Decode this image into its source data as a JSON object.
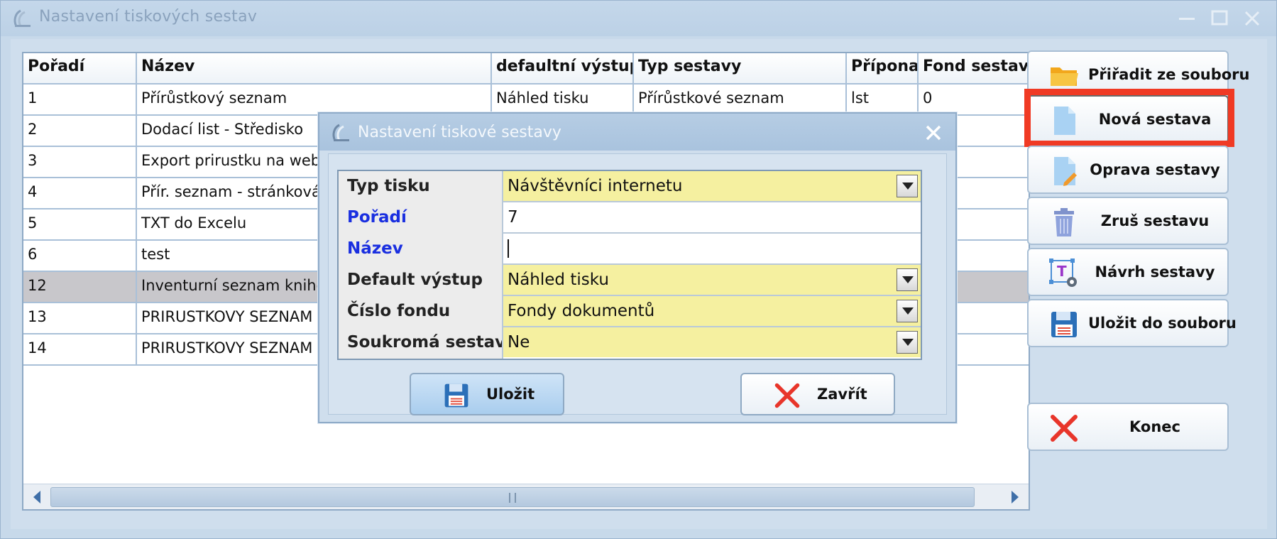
{
  "window": {
    "title": "Nastavení tiskových sestav"
  },
  "grid": {
    "columns": [
      "Pořadí",
      "Název",
      "defaultní výstup",
      "Typ sestavy",
      "Přípona",
      "Fond sestav"
    ],
    "rows": [
      [
        "1",
        "Přírůstkový seznam",
        "Náhled tisku",
        "Přírůstkové seznam",
        "lst",
        "0"
      ],
      [
        "2",
        "Dodací list - Středisko",
        "",
        "",
        "",
        ""
      ],
      [
        "3",
        "Export prirustku na web",
        "",
        "",
        "",
        ""
      ],
      [
        "4",
        "Přír. seznam - stránková s",
        "",
        "",
        "",
        ""
      ],
      [
        "5",
        "TXT do Excelu",
        "",
        "",
        "",
        ""
      ],
      [
        "6",
        "test",
        "",
        "",
        "",
        ""
      ],
      [
        "12",
        "Inventurní seznam knihovn",
        "",
        "",
        "",
        ""
      ],
      [
        "13",
        "PRIRUSTKOVY SEZNAM NA",
        "",
        "",
        "",
        ""
      ],
      [
        "14",
        "PRIRUSTKOVY SEZNAM KO",
        "",
        "",
        "",
        ""
      ]
    ],
    "selected_row": 6
  },
  "buttons": {
    "assign_from_file": "Přiřadit ze souboru",
    "new_report": "Nová sestava",
    "edit_report": "Oprava sestavy",
    "delete_report": "Zruš sestavu",
    "design_report": "Návrh sestavy",
    "save_to_file": "Uložit do souboru",
    "end": "Konec"
  },
  "dialog": {
    "title": "Nastavení tiskové sestavy",
    "fields": {
      "typ_tisku": {
        "label": "Typ tisku",
        "value": "Návštěvníci internetu"
      },
      "poradi": {
        "label": "Pořadí",
        "value": "7"
      },
      "nazev": {
        "label": "Název",
        "value": ""
      },
      "default_vystup": {
        "label": "Default výstup",
        "value": "Náhled tisku"
      },
      "cislo_fondu": {
        "label": "Číslo fondu",
        "value": "Fondy dokumentů"
      },
      "soukroma": {
        "label": "Soukromá sestava",
        "value": "Ne"
      }
    },
    "save_label": "Uložit",
    "close_label": "Zavřít"
  },
  "colors": {
    "highlight": "#f03a24",
    "required_label": "#1a2fe0",
    "lookup_field": "#f5f0a0",
    "selected_row": "#c8c7cb"
  }
}
